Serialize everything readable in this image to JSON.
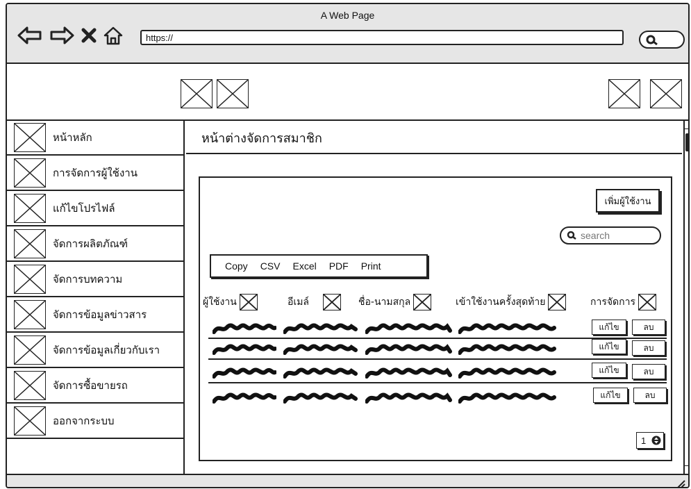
{
  "browser": {
    "window_title": "A Web Page",
    "url": "https://",
    "icons": [
      "back-arrow-icon",
      "forward-arrow-icon",
      "close-x-icon",
      "home-icon",
      "search-icon"
    ]
  },
  "header": {
    "placeholders": [
      "image-placeholder",
      "image-placeholder",
      "image-placeholder",
      "image-placeholder"
    ]
  },
  "sidebar": {
    "items": [
      {
        "label": "หน้าหลัก"
      },
      {
        "label": "การจัดการผู้ใช้งาน"
      },
      {
        "label": "แก้ไขโปรไฟล์"
      },
      {
        "label": "จัดการผลิตภัณฑ์"
      },
      {
        "label": "จัดการบทความ"
      },
      {
        "label": "จัดการข้อมูลข่าวสาร"
      },
      {
        "label": "จัดการข้อมูลเกี่ยวกับเรา"
      },
      {
        "label": "จัดการซื้อขายรถ"
      },
      {
        "label": "ออกจากระบบ"
      }
    ]
  },
  "main": {
    "title": "หน้าต่างจัดการสมาชิก",
    "add_button": "เพิ่มผู้ใช้งาน",
    "search_placeholder": "search",
    "export_buttons": [
      "Copy",
      "CSV",
      "Excel",
      "PDF",
      "Print"
    ],
    "columns": [
      "ผู้ใช้งาน",
      "อีเมล์",
      "ชื่อ-นามสกุล",
      "เข้าใช้งานครั้งสุดท้าย",
      "การจัดการ"
    ],
    "row_count": 4,
    "edit_label": "แก้ไข",
    "delete_label": "ลบ",
    "page_number": "1"
  }
}
